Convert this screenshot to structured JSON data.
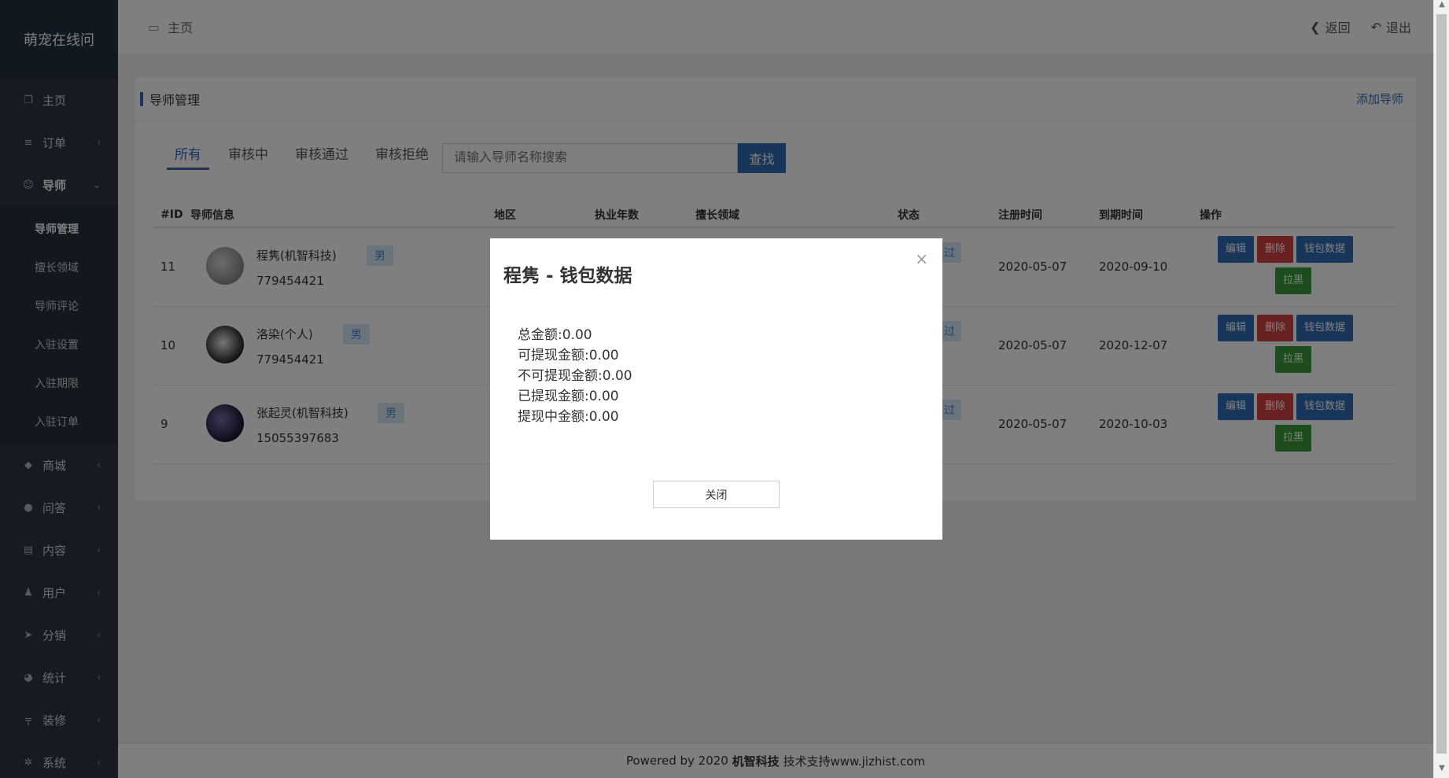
{
  "app": {
    "title": "萌宠在线问"
  },
  "sidebar": {
    "items": [
      {
        "label": "主页",
        "icon": "copy-icon"
      },
      {
        "label": "订单",
        "icon": "list-icon"
      },
      {
        "label": "导师",
        "icon": "user-icon"
      },
      {
        "label": "商城",
        "icon": "tag-icon"
      },
      {
        "label": "问答",
        "icon": "chat-icon"
      },
      {
        "label": "内容",
        "icon": "book-icon"
      },
      {
        "label": "用户",
        "icon": "person-icon"
      },
      {
        "label": "分销",
        "icon": "send-icon"
      },
      {
        "label": "统计",
        "icon": "pie-icon"
      },
      {
        "label": "装修",
        "icon": "tool-icon"
      },
      {
        "label": "系统",
        "icon": "gear-icon"
      }
    ],
    "tutor_sub": [
      "导师管理",
      "擅长领域",
      "导师评论",
      "入驻设置",
      "入驻期限",
      "入驻订单"
    ]
  },
  "topbar": {
    "home": "主页",
    "back": "返回",
    "logout": "退出"
  },
  "panel": {
    "title": "导师管理",
    "add": "添加导师"
  },
  "tabs": [
    "所有",
    "审核中",
    "审核通过",
    "审核拒绝"
  ],
  "search": {
    "placeholder": "请输入导师名称搜索",
    "button": "查找"
  },
  "table": {
    "headers": [
      "#ID",
      "导师信息",
      "地区",
      "执业年数",
      "擅长领域",
      "状态",
      "注册时间",
      "到期时间",
      "操作"
    ],
    "rows": [
      {
        "id": "11",
        "name": "程隽(机智科技)",
        "phone": "779454421",
        "gender": "男",
        "status": "过",
        "reg": "2020-05-07",
        "exp": "2020-09-10"
      },
      {
        "id": "10",
        "name": "洛染(个人)",
        "phone": "779454421",
        "gender": "男",
        "status": "过",
        "reg": "2020-05-07",
        "exp": "2020-12-07"
      },
      {
        "id": "9",
        "name": "张起灵(机智科技)",
        "phone": "15055397683",
        "gender": "男",
        "status": "过",
        "reg": "2020-05-07",
        "exp": "2020-10-03"
      }
    ],
    "actions": {
      "edit": "编辑",
      "delete": "删除",
      "wallet": "钱包数据",
      "block": "拉黑"
    }
  },
  "footer": {
    "prefix": "Powered by 2020 ",
    "brand": "机智科技",
    "suffix": " 技术支持www.jizhist.com"
  },
  "modal": {
    "title": "程隽 - 钱包数据",
    "lines": [
      "总金额:0.00",
      "可提现金额:0.00",
      "不可提现金额:0.00",
      "已提现金额:0.00",
      "提现中金额:0.00"
    ],
    "close_label": "关闭",
    "close_x": "×"
  }
}
